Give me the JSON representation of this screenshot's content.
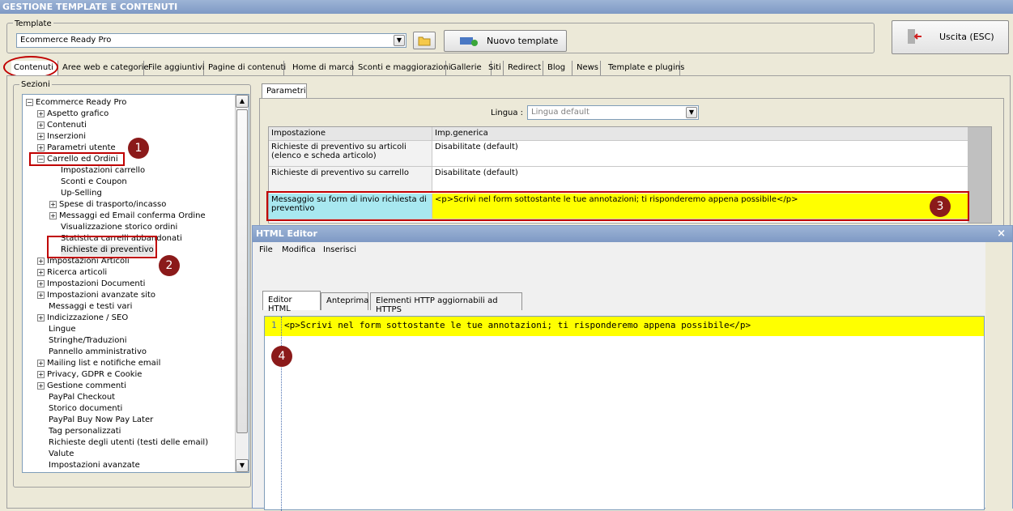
{
  "window": {
    "title": "GESTIONE TEMPLATE E CONTENUTI"
  },
  "template": {
    "group_label": "Template",
    "selected": "Ecommerce Ready Pro",
    "new_button": "Nuovo template",
    "exit_button": "Uscita (ESC)"
  },
  "tabs": [
    "Contenuti",
    "Aree web e categorie",
    "File aggiuntivi",
    "Pagine di contenuti",
    "Home di marca",
    "Sconti e maggiorazioni",
    "Gallerie",
    "Siti",
    "Redirect",
    "Blog",
    "News",
    "Template e plugins"
  ],
  "sections": {
    "label": "Sezioni",
    "items": [
      "Ecommerce Ready Pro",
      "Aspetto grafico",
      "Contenuti",
      "Inserzioni",
      "Parametri utente",
      "Carrello ed Ordini",
      "Impostazioni carrello",
      "Sconti e Coupon",
      "Up-Selling",
      "Spese di trasporto/incasso",
      "Messaggi ed Email conferma Ordine",
      "Visualizzazione storico ordini",
      "Statistica carrelli abbandonati",
      "Richieste di preventivo",
      "Impostazioni Articoli",
      "Ricerca articoli",
      "Impostazioni Documenti",
      "Impostazioni avanzate sito",
      "Messaggi e testi vari",
      "Indicizzazione / SEO",
      "Lingue",
      "Stringhe/Traduzioni",
      "Pannello amministrativo",
      "Mailing list e notifiche email",
      "Privacy, GDPR e Cookie",
      "Gestione commenti",
      "PayPal Checkout",
      "Storico documenti",
      "PayPal Buy Now Pay Later",
      "Tag personalizzati",
      "Richieste degli utenti (testi delle email)",
      "Valute",
      "Impostazioni avanzate"
    ]
  },
  "params": {
    "tab": "Parametri",
    "lang_label": "Lingua :",
    "lang_value": "Lingua default",
    "col1": "Impostazione",
    "col2": "Imp.generica",
    "rows": [
      {
        "k": "Richieste di preventivo su articoli (elenco e scheda articolo)",
        "v": "Disabilitate (default)"
      },
      {
        "k": "Richieste di preventivo su carrello",
        "v": "Disabilitate (default)"
      },
      {
        "k": "Messaggio su form di invio richiesta di preventivo",
        "v": "<p>Scrivi nel form sottostante le tue annotazioni; ti risponderemo appena possibile</p>"
      }
    ]
  },
  "editor": {
    "title": "HTML Editor",
    "menu": [
      "File",
      "Modifica",
      "Inserisci"
    ],
    "tabs": [
      "Editor HTML",
      "Anteprima",
      "Elementi HTTP aggiornabili ad HTTPS"
    ],
    "line_no": "1",
    "code": "<p>Scrivi nel form sottostante le tue annotazioni; ti risponderemo appena possibile</p>",
    "close": "×"
  },
  "markers": [
    "1",
    "2",
    "3",
    "4"
  ],
  "colors": {
    "highlight": "#ffff00",
    "annotation": "#c00000",
    "marker": "#8b1a1a"
  }
}
